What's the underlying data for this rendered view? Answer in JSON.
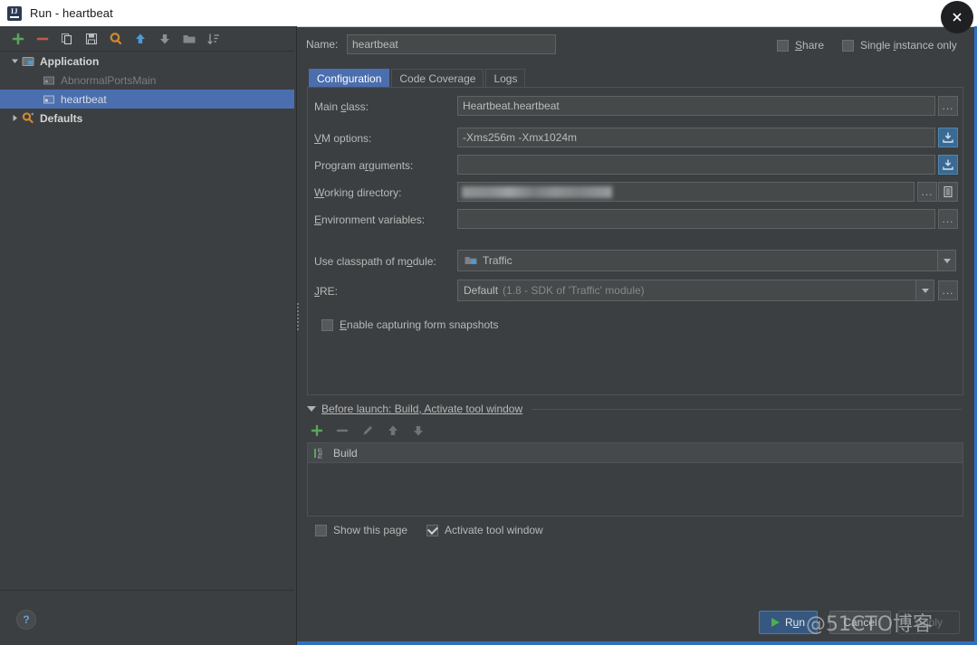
{
  "window": {
    "title": "Run - heartbeat",
    "app_icon": "intellij-idea-icon",
    "close_label": "✕"
  },
  "left_panel": {
    "toolbar": [
      {
        "name": "add-configuration-button",
        "icon": "plus-icon"
      },
      {
        "name": "remove-configuration-button",
        "icon": "minus-icon"
      },
      {
        "name": "copy-configuration-button",
        "icon": "copy-icon"
      },
      {
        "name": "save-configuration-button",
        "icon": "save-icon"
      },
      {
        "name": "edit-templates-button",
        "icon": "gear-icon"
      },
      {
        "name": "move-up-button",
        "icon": "arrow-up-icon"
      },
      {
        "name": "move-down-button",
        "icon": "arrow-down-icon"
      },
      {
        "name": "new-folder-button",
        "icon": "folder-icon"
      },
      {
        "name": "sort-configurations-button",
        "icon": "sort-icon"
      }
    ],
    "tree": [
      {
        "label": "Application",
        "icon": "application-icon",
        "level": 0,
        "expanded": true,
        "selected": false,
        "dim": false
      },
      {
        "label": "AbnormalPortsMain",
        "icon": "java-class-icon",
        "level": 1,
        "expanded": null,
        "selected": false,
        "dim": true
      },
      {
        "label": "heartbeat",
        "icon": "java-class-icon",
        "level": 1,
        "expanded": null,
        "selected": true,
        "dim": false
      },
      {
        "label": "Defaults",
        "icon": "defaults-icon",
        "level": 0,
        "expanded": false,
        "selected": false,
        "dim": false
      }
    ],
    "help_label": "?"
  },
  "header": {
    "name_label": "Name:",
    "name_value": "heartbeat",
    "name_placeholder": "",
    "share": {
      "label": "Share",
      "checked": false
    },
    "single_instance": {
      "label": "Single instance only",
      "checked": false
    }
  },
  "tabs": [
    {
      "label": "Configuration",
      "active": true
    },
    {
      "label": "Code Coverage",
      "active": false
    },
    {
      "label": "Logs",
      "active": false
    }
  ],
  "configuration": {
    "main_class": {
      "label": "Main class:",
      "value": "Heartbeat.heartbeat",
      "placeholder": "",
      "browse": "..."
    },
    "vm_options": {
      "label": "VM options:",
      "value": "-Xms256m -Xmx1024m",
      "placeholder": "",
      "expand": "expand-icon"
    },
    "program_arguments": {
      "label": "Program arguments:",
      "value": "",
      "placeholder": "",
      "expand": "expand-icon"
    },
    "working_directory": {
      "label": "Working directory:",
      "value": "",
      "placeholder": "",
      "redacted": true,
      "browse": "...",
      "macros": "macros-icon"
    },
    "environment_variables": {
      "label": "Environment variables:",
      "value": "",
      "placeholder": "",
      "browse": "..."
    },
    "use_classpath": {
      "label": "Use classpath of module:",
      "value": "Traffic",
      "icon": "module-icon"
    },
    "jre": {
      "label": "JRE:",
      "value": "Default",
      "hint": "(1.8 - SDK of 'Traffic' module)",
      "browse": "..."
    },
    "enable_capturing": {
      "label": "Enable capturing form snapshots",
      "checked": false
    }
  },
  "before_launch": {
    "header": "Before launch: Build, Activate tool window",
    "toolbar": [
      {
        "name": "add-task-button",
        "icon": "plus-icon"
      },
      {
        "name": "remove-task-button",
        "icon": "minus-icon"
      },
      {
        "name": "edit-task-button",
        "icon": "pencil-icon"
      },
      {
        "name": "move-task-up-button",
        "icon": "arrow-up-icon"
      },
      {
        "name": "move-task-down-button",
        "icon": "arrow-down-icon"
      }
    ],
    "items": [
      {
        "label": "Build",
        "icon": "build-icon"
      }
    ],
    "show_this_page": {
      "label": "Show this page",
      "checked": false
    },
    "activate_tool_window": {
      "label": "Activate tool window",
      "checked": true
    }
  },
  "footer": {
    "run": {
      "label": "Run",
      "icon": "play-icon",
      "enabled": true
    },
    "cancel": {
      "label": "Cancel",
      "enabled": true
    },
    "apply": {
      "label": "Apply",
      "enabled": false
    }
  },
  "watermark": "@51CTO博客",
  "colors": {
    "window_bg": "#3c3f41",
    "field_bg": "#45494a",
    "selection_blue": "#4b6eaf",
    "accent_blue": "#2e6fc4",
    "primary_button": "#365880",
    "text": "#bbbbbb",
    "dim_text": "#7a7d80",
    "green": "#4caf50"
  }
}
